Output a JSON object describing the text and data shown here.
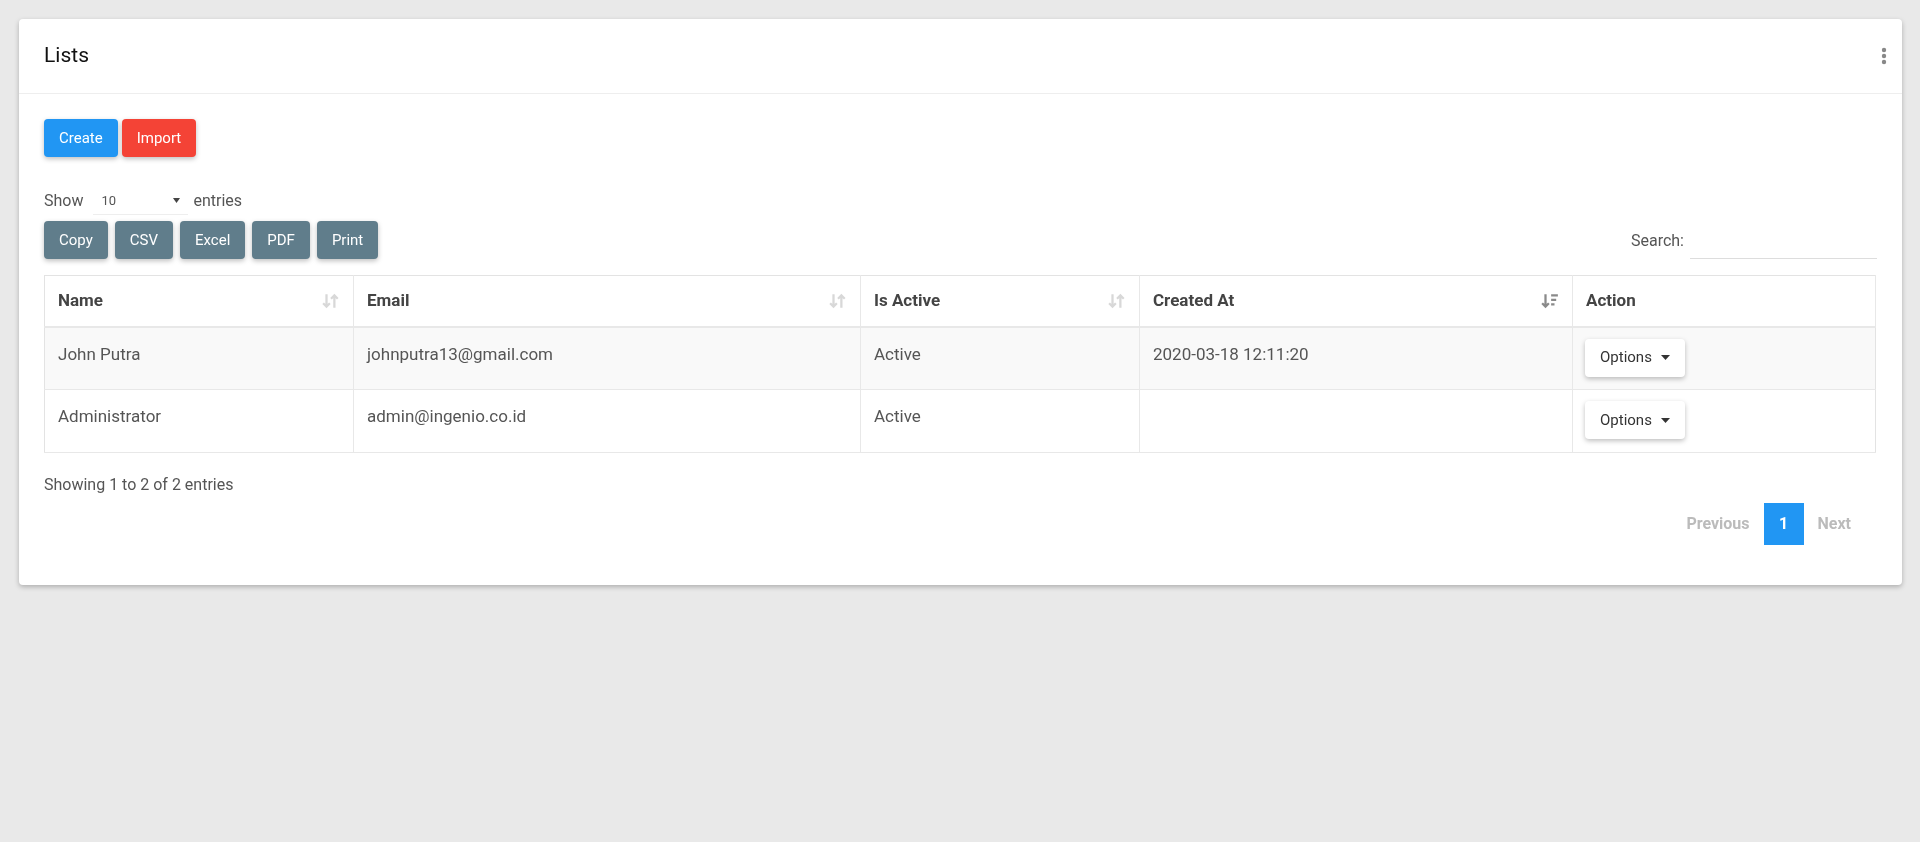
{
  "card": {
    "title": "Lists"
  },
  "actions": [
    {
      "label": "Create",
      "kind": "primary"
    },
    {
      "label": "Import",
      "kind": "danger"
    }
  ],
  "length": {
    "before": "Show",
    "value": "10",
    "after": "entries"
  },
  "exports": [
    "Copy",
    "CSV",
    "Excel",
    "PDF",
    "Print"
  ],
  "search": {
    "label": "Search:"
  },
  "table": {
    "columns": [
      {
        "label": "Name",
        "sortable": true,
        "sorted_descending": false
      },
      {
        "label": "Email",
        "sortable": true,
        "sorted_descending": false
      },
      {
        "label": "Is Active",
        "sortable": true,
        "sorted_descending": false
      },
      {
        "label": "Created At",
        "sortable": true,
        "sorted_descending": true
      },
      {
        "label": "Action"
      }
    ],
    "rows": [
      {
        "cells": [
          "John Putra",
          "johnputra13@gmail.com",
          "Active",
          "2020-03-18 12:11:20"
        ],
        "action": "Options"
      },
      {
        "cells": [
          "Administrator",
          "admin@ingenio.co.id",
          "Active",
          ""
        ],
        "action": "Options"
      }
    ]
  },
  "info": "Showing 1 to 2 of 2 entries",
  "pagination": {
    "previous": {
      "label": "Previous",
      "disabled": true
    },
    "pages": [
      {
        "label": "1",
        "selected": true
      }
    ],
    "next": {
      "label": "Next",
      "disabled": true
    }
  }
}
